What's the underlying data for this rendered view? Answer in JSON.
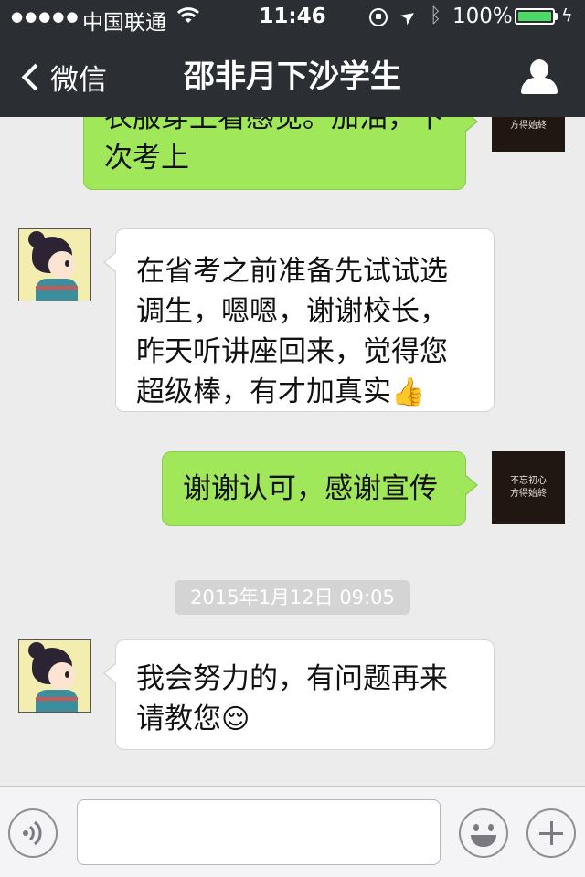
{
  "status_bar": {
    "signal": "●●●●●",
    "carrier": "中国联通",
    "wifi": "⩫",
    "time": "11:46",
    "battery_percent": "100%",
    "battery_level": 1.0
  },
  "nav": {
    "back_label": "微信",
    "title": "邵非月下沙学生"
  },
  "messages": [
    {
      "from": "me",
      "text": "衣服穿上看感觉。加油，下次考上"
    },
    {
      "from": "friend",
      "text": "在省考之前准备先试试选调生，嗯嗯，谢谢校长，昨天听讲座回来，觉得您超级棒，有才加真实",
      "emoji": "👍"
    },
    {
      "from": "me",
      "text": "谢谢认可，感谢宣传"
    },
    {
      "from": "friend",
      "text": "我会努力的，有问题再来请教您",
      "emoji": "😌"
    }
  ],
  "timestamp": "2015年1月12日 09:05",
  "my_avatar_text": [
    "不忘初心",
    "方得始終"
  ],
  "input": {
    "value": "",
    "placeholder": ""
  },
  "colors": {
    "header_bg": "#2b2e33",
    "chat_bg": "#ececec",
    "outgoing_bubble": "#a0e759",
    "incoming_bubble": "#ffffff",
    "battery_fill": "#4cd964"
  }
}
